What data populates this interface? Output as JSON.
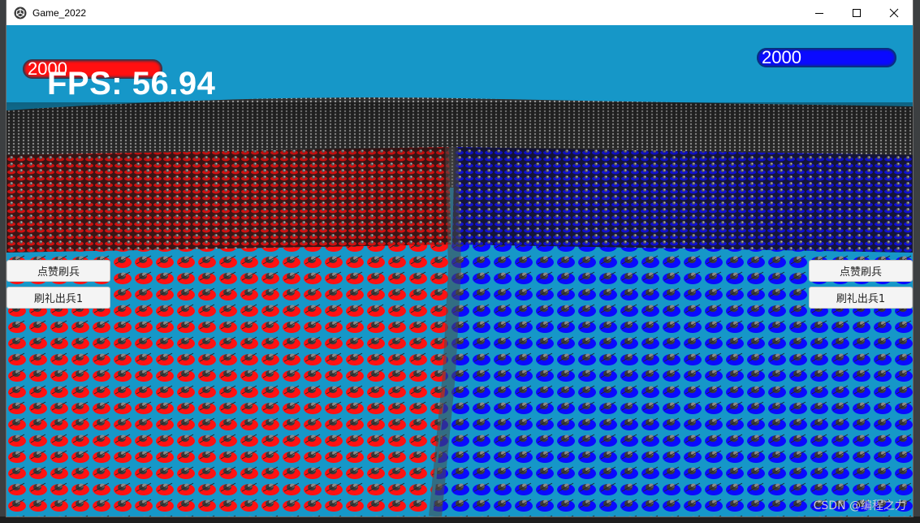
{
  "window": {
    "title": "Game_2022"
  },
  "hud": {
    "left_hp": "2000",
    "right_hp": "2000",
    "fps": "FPS: 56.94"
  },
  "buttons": {
    "left_like": "点赞刷兵",
    "left_gift": "刷礼出兵1",
    "right_like": "点赞刷兵",
    "right_gift": "刷礼出兵1"
  },
  "watermark": "CSDN @编程之力",
  "colors": {
    "sky": "#1697c8",
    "red_team": "#ff1010",
    "blue_team": "#0a0aff"
  },
  "icons": {
    "app": "unity-logo-icon",
    "minimize": "minimize-icon",
    "maximize": "maximize-icon",
    "close": "close-icon"
  }
}
